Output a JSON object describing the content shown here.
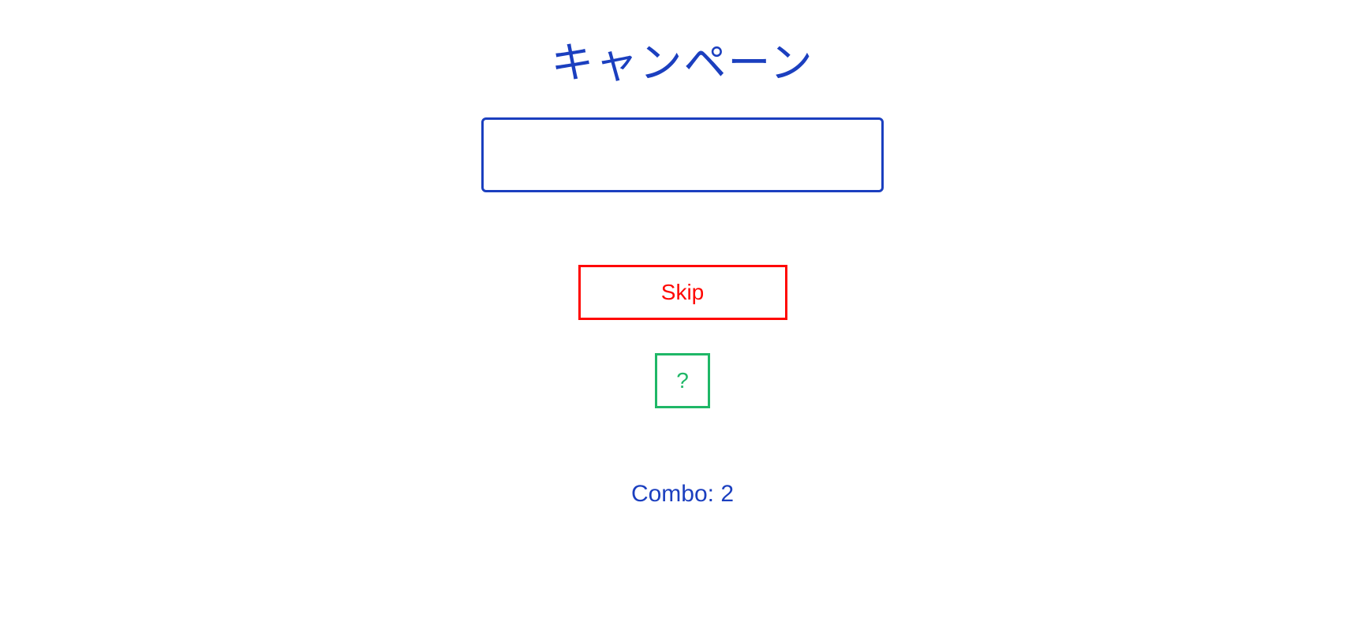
{
  "prompt": {
    "word": "キャンペーン"
  },
  "input": {
    "value": "",
    "placeholder": ""
  },
  "buttons": {
    "skip_label": "Skip",
    "hint_label": "?"
  },
  "status": {
    "combo_label": "Combo: 2",
    "combo_value": 2
  },
  "colors": {
    "primary_blue": "#1B3FBF",
    "skip_red": "#FF0600",
    "hint_green": "#1FB767"
  }
}
